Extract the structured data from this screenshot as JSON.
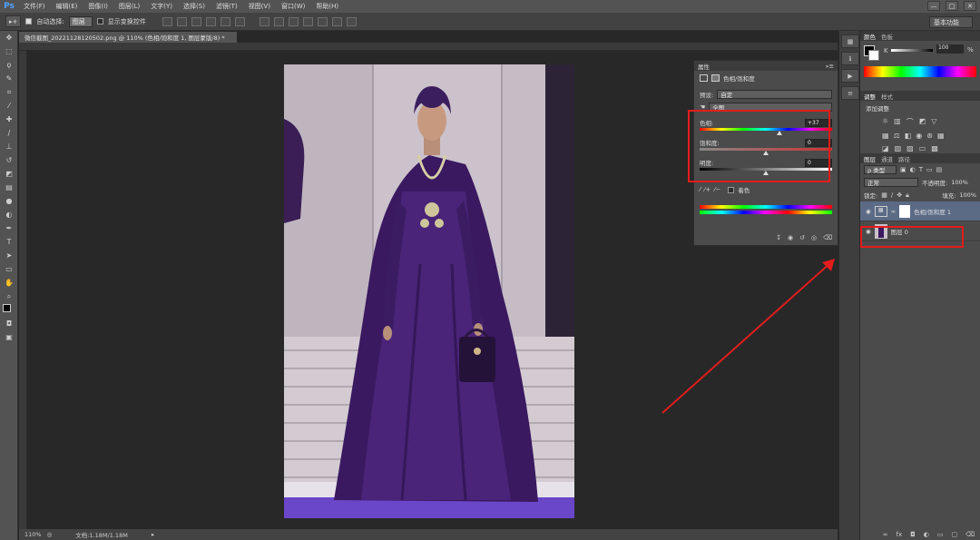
{
  "app": {
    "logo": "Ps"
  },
  "menu": [
    "文件(F)",
    "编辑(E)",
    "图像(I)",
    "图层(L)",
    "文字(Y)",
    "选择(S)",
    "滤镜(T)",
    "视图(V)",
    "窗口(W)",
    "帮助(H)"
  ],
  "window_controls": {
    "minimize": "—",
    "restore": "□",
    "close": "✕"
  },
  "options": {
    "auto_select_label": "自动选择:",
    "auto_select_value": "图层",
    "show_transform_label": "显示变换控件",
    "workspace": "基本功能"
  },
  "document": {
    "tab_title": "微信截图_20221128120502.png @ 110% (色相/饱和度 1, 图层蒙版/8) *",
    "zoom": "110%",
    "doc_size": "文档:1.18M/1.18M"
  },
  "properties": {
    "tab": "属性",
    "header": "色相/饱和度",
    "preset_label": "预设:",
    "preset_value": "自定",
    "channel_value": "全图",
    "hue_label": "色相:",
    "hue_value": "+37",
    "hue_fraction": 0.6,
    "saturation_label": "饱和度:",
    "saturation_value": "0",
    "saturation_fraction": 0.5,
    "lightness_label": "明度:",
    "lightness_value": "0",
    "lightness_fraction": 0.5,
    "colorize_label": "着色"
  },
  "color_panel": {
    "tabs": [
      "颜色",
      "色板"
    ],
    "k_label": "K",
    "k_value": "100",
    "k_unit": "%"
  },
  "adjust_panel": {
    "tabs": [
      "调整",
      "样式"
    ],
    "title": "添加调整"
  },
  "layers_panel": {
    "tabs": [
      "图层",
      "通道",
      "路径"
    ],
    "kind_label": "ρ 类型",
    "blend_mode": "正常",
    "opacity_label": "不透明度:",
    "opacity_value": "100%",
    "lock_label": "锁定:",
    "fill_label": "填充:",
    "fill_value": "100%",
    "layers": [
      {
        "name": "色相/饱和度 1",
        "type": "adjustment"
      },
      {
        "name": "图层 0",
        "type": "image"
      }
    ]
  },
  "colors": {
    "annotation_red": "#e21c1c",
    "dress_purple": "#3d1a5e",
    "accent_blue": "#4fa3ff"
  }
}
